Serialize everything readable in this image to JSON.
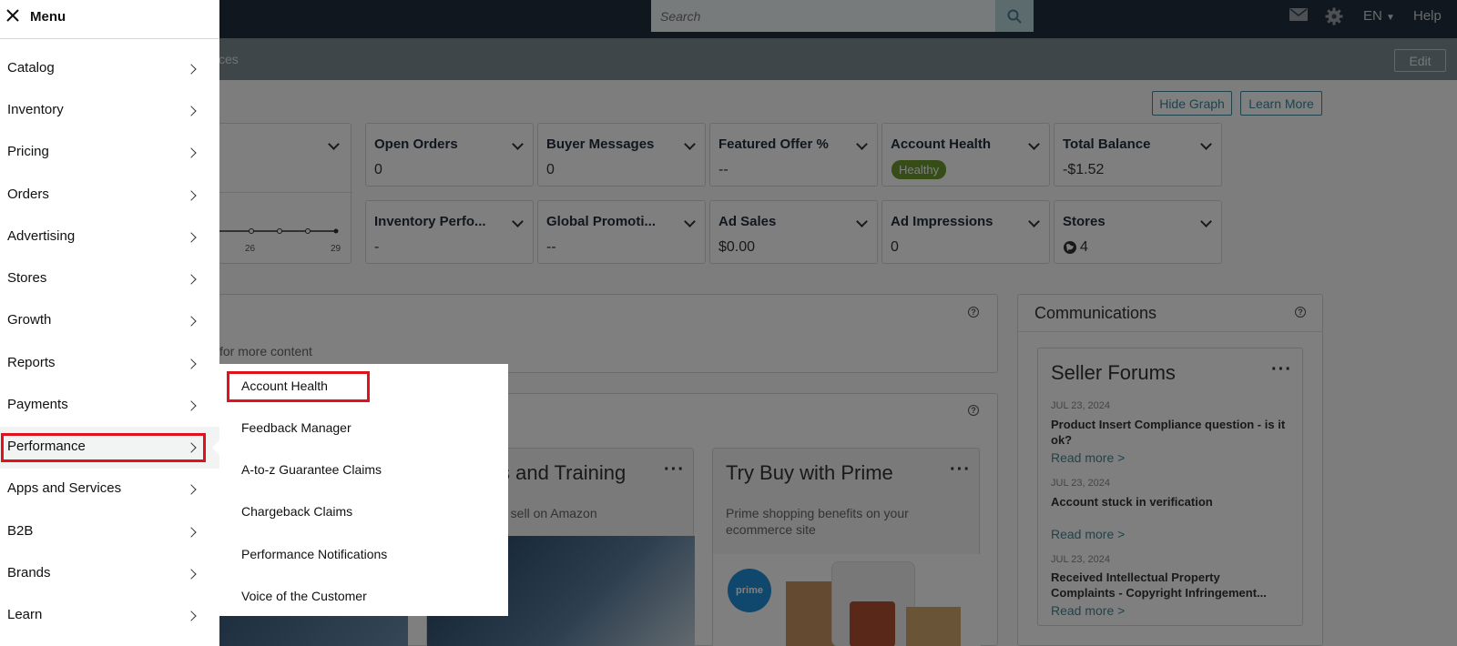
{
  "topbar": {
    "search_placeholder": "Search",
    "language": "EN",
    "help": "Help"
  },
  "subbar": {
    "partial_text": "ces",
    "edit_label": "Edit"
  },
  "graph_buttons": {
    "hide_graph": "Hide Graph",
    "learn_more": "Learn More"
  },
  "metrics": [
    {
      "label": "Open Orders",
      "value": "0"
    },
    {
      "label": "Buyer Messages",
      "value": "0"
    },
    {
      "label": "Featured Offer %",
      "value": "--"
    },
    {
      "label": "Account Health",
      "value": "Healthy"
    },
    {
      "label": "Total Balance",
      "value": "-$1.52"
    },
    {
      "label": "Inventory Perfo...",
      "value": "-"
    },
    {
      "label": "Global Promoti...",
      "value": "--"
    },
    {
      "label": "Ad Sales",
      "value": "$0.00"
    },
    {
      "label": "Ad Impressions",
      "value": "0"
    },
    {
      "label": "Stores",
      "value": "4"
    }
  ],
  "mini_chart": {
    "ticks": [
      "26",
      "29"
    ]
  },
  "panels": {
    "more_content_text": "for more content",
    "communications_title": "Communications"
  },
  "widgets": {
    "training_title": "s and Training",
    "training_sub": "o sell on Amazon",
    "buy_prime_title": "Try Buy with Prime",
    "buy_prime_sub": "Prime shopping benefits on your ecommerce site",
    "prime_logo_text": "prime"
  },
  "seller_forums": {
    "title": "Seller Forums",
    "posts": [
      {
        "date": "JUL 23, 2024",
        "title": "Product Insert Compliance question - is it ok?",
        "read": "Read more >"
      },
      {
        "date": "JUL 23, 2024",
        "title": "Account stuck in verification",
        "read": "Read more >"
      },
      {
        "date": "JUL 23, 2024",
        "title": "Received Intellectual Property Complaints - Copyright Infringement...",
        "read": "Read more >"
      }
    ]
  },
  "menu": {
    "title": "Menu",
    "items": [
      {
        "label": "Catalog"
      },
      {
        "label": "Inventory"
      },
      {
        "label": "Pricing"
      },
      {
        "label": "Orders"
      },
      {
        "label": "Advertising"
      },
      {
        "label": "Stores"
      },
      {
        "label": "Growth"
      },
      {
        "label": "Reports"
      },
      {
        "label": "Payments"
      },
      {
        "label": "Performance"
      },
      {
        "label": "Apps and Services"
      },
      {
        "label": "B2B"
      },
      {
        "label": "Brands"
      },
      {
        "label": "Learn"
      }
    ]
  },
  "submenu": {
    "items": [
      {
        "label": "Account Health"
      },
      {
        "label": "Feedback Manager"
      },
      {
        "label": "A-to-z Guarantee Claims"
      },
      {
        "label": "Chargeback Claims"
      },
      {
        "label": "Performance Notifications"
      },
      {
        "label": "Voice of the Customer"
      }
    ]
  },
  "colors": {
    "highlight": "#e0121c",
    "topbar": "#232f3e",
    "accent": "#3f8798",
    "healthy": "#6c9a2e"
  }
}
